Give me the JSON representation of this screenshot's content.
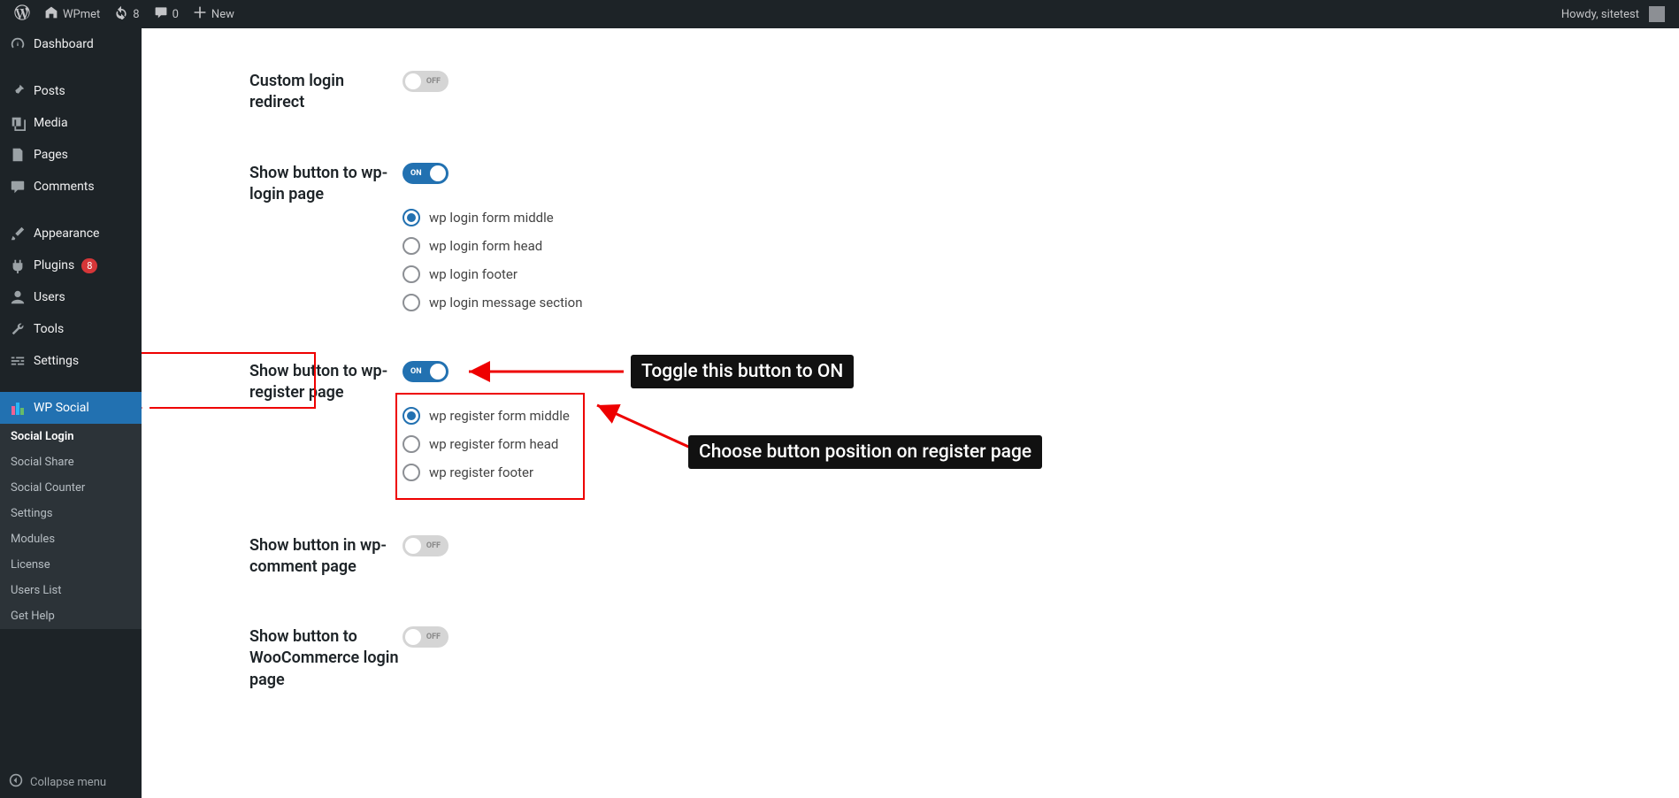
{
  "adminbar": {
    "site_name": "WPmet",
    "updates_count": "8",
    "comments_count": "0",
    "new_label": "New",
    "howdy": "Howdy, sitetest"
  },
  "sidebar": {
    "dashboard": "Dashboard",
    "posts": "Posts",
    "media": "Media",
    "pages": "Pages",
    "comments": "Comments",
    "appearance": "Appearance",
    "plugins": "Plugins",
    "plugins_badge": "8",
    "users": "Users",
    "tools": "Tools",
    "settings": "Settings",
    "wpsocial": "WP Social",
    "collapse": "Collapse menu"
  },
  "submenu": {
    "social_login": "Social Login",
    "social_share": "Social Share",
    "social_counter": "Social Counter",
    "settings": "Settings",
    "modules": "Modules",
    "license": "License",
    "users_list": "Users List",
    "get_help": "Get Help"
  },
  "settings": {
    "custom_login_redirect": {
      "label": "Custom login redirect",
      "state": "OFF"
    },
    "show_login": {
      "label": "Show button to wp-login page",
      "state": "ON",
      "options": [
        "wp login form middle",
        "wp login form head",
        "wp login footer",
        "wp login message section"
      ],
      "selected": 0
    },
    "show_register": {
      "label": "Show button to wp-register page",
      "state": "ON",
      "options": [
        "wp register form middle",
        "wp register form head",
        "wp register footer"
      ],
      "selected": 0
    },
    "show_comment": {
      "label": "Show button in wp-comment page",
      "state": "OFF"
    },
    "show_woo": {
      "label": "Show button to WooCommerce login page",
      "state": "OFF"
    }
  },
  "annotations": {
    "toggle_hint": "Toggle this button to ON",
    "position_hint": "Choose button position on register page"
  }
}
